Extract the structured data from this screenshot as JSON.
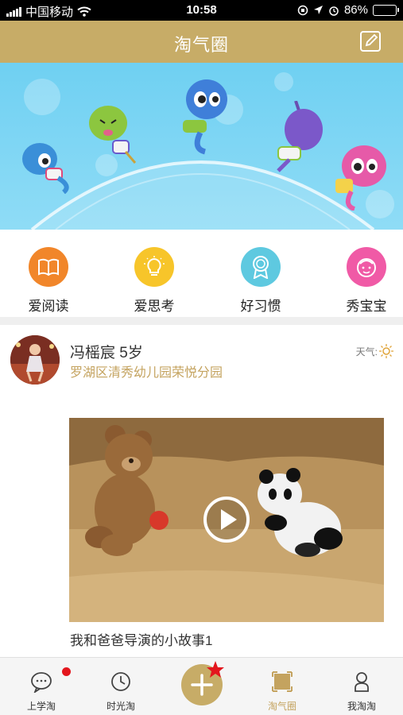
{
  "status_bar": {
    "carrier": "中国移动",
    "time": "10:58",
    "battery": "86%",
    "battery_level": 0.86
  },
  "header": {
    "title": "淘气圈",
    "edit_icon": "edit-icon"
  },
  "categories": [
    {
      "label": "爱阅读",
      "icon": "book-icon",
      "color": "#f1862a"
    },
    {
      "label": "爱思考",
      "icon": "lightbulb-icon",
      "color": "#f7c52a"
    },
    {
      "label": "好习惯",
      "icon": "medal-icon",
      "color": "#5ec9e0"
    },
    {
      "label": "秀宝宝",
      "icon": "baby-face-icon",
      "color": "#f05aa6"
    }
  ],
  "post": {
    "name": "冯榣宸 5岁",
    "school": "罗湖区清秀幼儿园荣悦分园",
    "weather_label": "天气:",
    "caption": "我和爸爸导演的小故事1"
  },
  "tabs": [
    {
      "label": "上学淘",
      "icon": "chat-bubble-icon",
      "badge": true
    },
    {
      "label": "时光淘",
      "icon": "clock-icon"
    },
    {
      "label": "",
      "icon": "plus-icon"
    },
    {
      "label": "淘气圈",
      "icon": "square-frame-icon",
      "active": true
    },
    {
      "label": "我淘淘",
      "icon": "person-icon"
    }
  ],
  "colors": {
    "brand_gold": "#c7ac67",
    "school_text": "#c4a35f",
    "badge_red": "#e3161d"
  }
}
